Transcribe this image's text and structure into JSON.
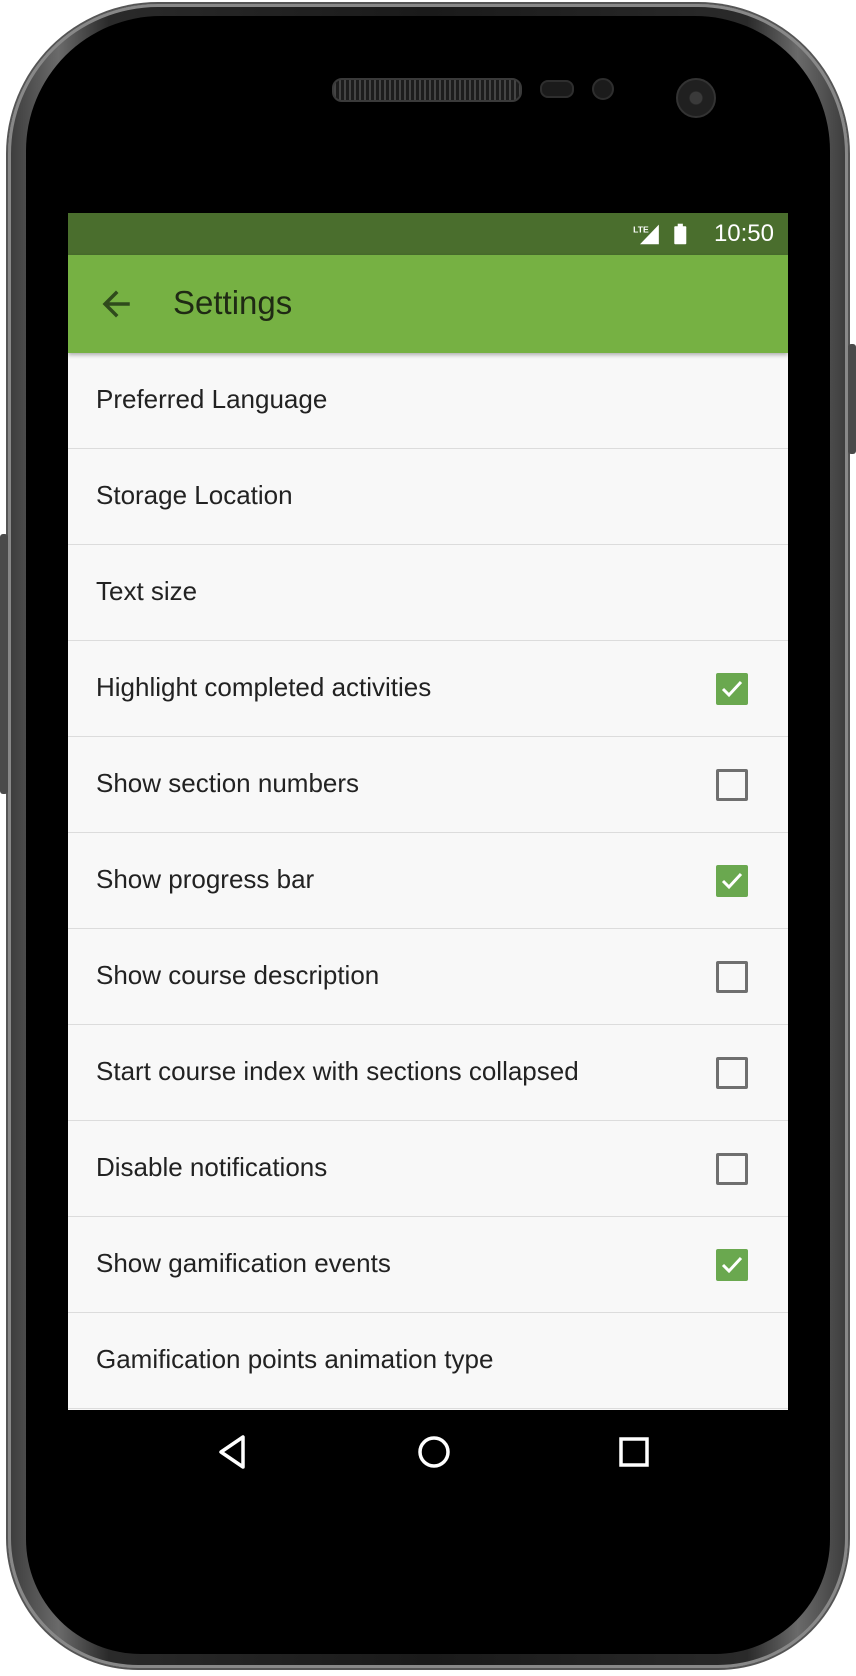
{
  "status_bar": {
    "time": "10:50",
    "network": "LTE"
  },
  "app_bar": {
    "title": "Settings",
    "back_icon": "arrow-back-icon"
  },
  "settings": [
    {
      "label": "Preferred Language",
      "checkbox": null
    },
    {
      "label": "Storage Location",
      "checkbox": null
    },
    {
      "label": "Text size",
      "checkbox": null
    },
    {
      "label": "Highlight completed activities",
      "checkbox": true
    },
    {
      "label": "Show section numbers",
      "checkbox": false
    },
    {
      "label": "Show progress bar",
      "checkbox": true
    },
    {
      "label": "Show course description",
      "checkbox": false
    },
    {
      "label": "Start course index with sections collapsed",
      "checkbox": false
    },
    {
      "label": "Disable notifications",
      "checkbox": false
    },
    {
      "label": "Show gamification events",
      "checkbox": true
    },
    {
      "label": "Gamification points animation type",
      "checkbox": null
    }
  ],
  "nav": {
    "back": "nav-back-icon",
    "home": "nav-home-icon",
    "recents": "nav-recents-icon"
  },
  "colors": {
    "status_bar": "#4a6e2d",
    "app_bar": "#76b143",
    "checkbox_checked": "#6aa84f"
  }
}
